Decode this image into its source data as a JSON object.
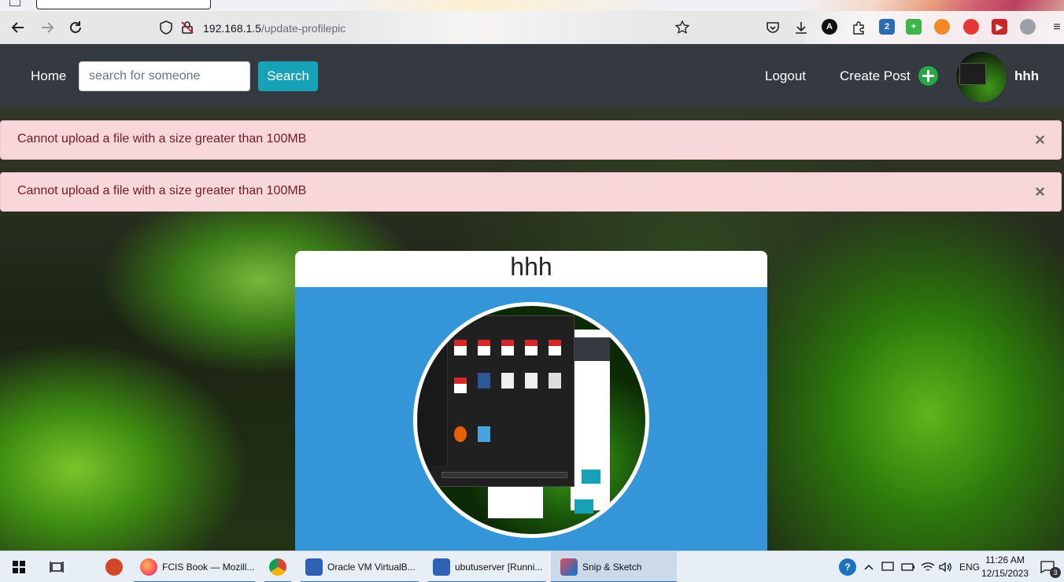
{
  "browser": {
    "url_host": "192.168.1.5",
    "url_path": "/update-profilepic"
  },
  "nav": {
    "home_label": "Home",
    "search_placeholder": "search for someone",
    "search_button": "Search",
    "logout_label": "Logout",
    "create_post_label": "Create Post",
    "username": "hhh"
  },
  "alerts": [
    {
      "message": "Cannot upload a file with a size greater than 100MB",
      "close": "×"
    },
    {
      "message": "Cannot upload a file with a size greater than 100MB",
      "close": "×"
    }
  ],
  "profile_card": {
    "name": "hhh"
  },
  "taskbar": {
    "apps": [
      {
        "label": "FCIS Book — Mozill...",
        "icon": "firefox-icon"
      },
      {
        "label": "Oracle VM VirtualB...",
        "icon": "virtualbox-icon"
      },
      {
        "label": "ubutuserver [Runni...",
        "icon": "vm-window-icon"
      },
      {
        "label": "Snip & Sketch",
        "icon": "snip-sketch-icon"
      }
    ],
    "language": "ENG",
    "time": "11:26 AM",
    "date": "12/15/2023",
    "notification_count": "3"
  },
  "colors": {
    "navbar_bg": "#343a40",
    "search_button": "#17a2b8",
    "create_post_plus": "#28a745",
    "alert_bg": "#f8d7da",
    "alert_text": "#721c24",
    "card_blue": "#3595d9"
  }
}
